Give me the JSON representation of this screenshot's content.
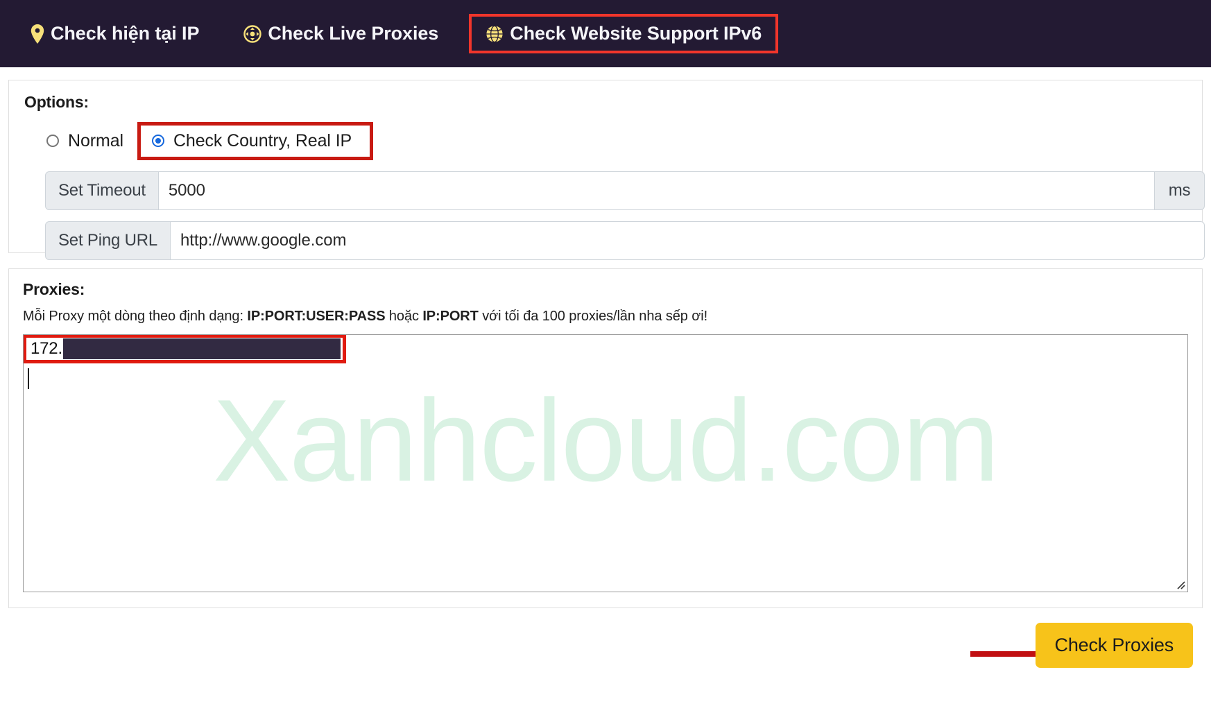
{
  "nav": {
    "items": [
      {
        "label": "Check hiện tại IP",
        "icon": "map-pin-icon",
        "highlighted": false
      },
      {
        "label": "Check Live Proxies",
        "icon": "crosshair-target-icon",
        "highlighted": false
      },
      {
        "label": "Check Website Support IPv6",
        "icon": "globe-icon",
        "highlighted": true
      }
    ],
    "background_color": "#231a33",
    "icon_color": "#f7e07a",
    "highlight_color": "#f1352b"
  },
  "options": {
    "title": "Options:",
    "radios": [
      {
        "label": "Normal",
        "checked": false
      },
      {
        "label": "Check Country, Real IP",
        "checked": true
      }
    ],
    "radio_accent_color": "#1668dd",
    "highlight_color": "#c81a12",
    "timeout": {
      "addon_label": "Set Timeout",
      "value": "5000",
      "suffix_label": "ms"
    },
    "ping_url": {
      "addon_label": "Set Ping URL",
      "value": "http://www.google.com"
    }
  },
  "proxies": {
    "title": "Proxies:",
    "hint_prefix": "Mỗi Proxy một dòng theo định dạng: ",
    "hint_format_1": "IP:PORT:USER:PASS",
    "hint_middle": " hoặc ",
    "hint_format_2": "IP:PORT",
    "hint_suffix": " với tối đa 100 proxies/lần nha sếp ơi!",
    "first_line_visible_text": "172.",
    "first_line_redacted": true,
    "watermark": "Xanhcloud.com",
    "watermark_color": "#d9f2e3",
    "highlight_color": "#e01b10"
  },
  "footer": {
    "submit_label": "Check Proxies",
    "submit_color": "#f7c31a",
    "arrow_color": "#c10f12",
    "arrow_name": "red-pointer-arrow"
  }
}
